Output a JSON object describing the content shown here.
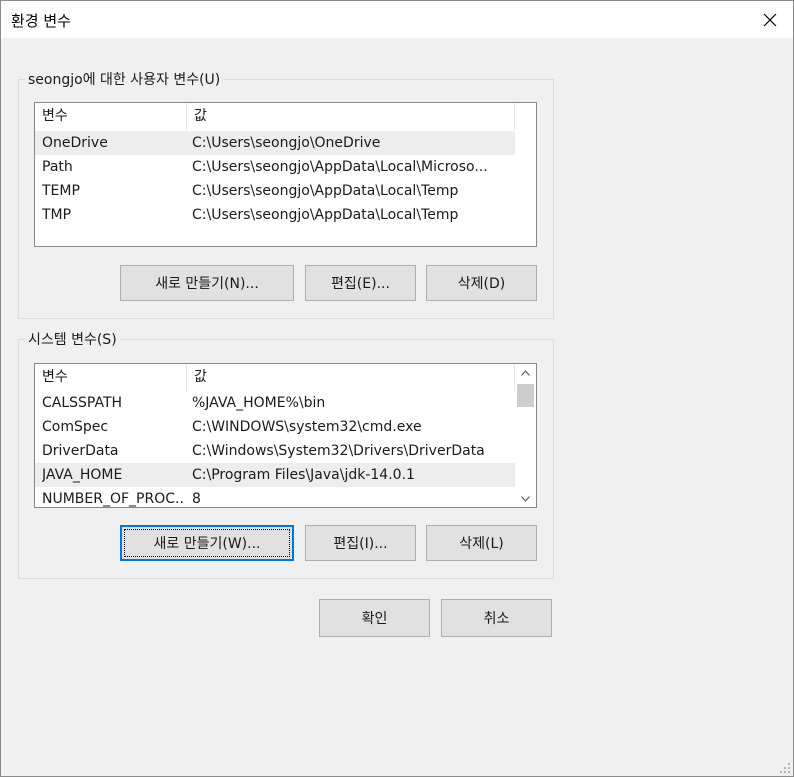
{
  "window": {
    "title": "환경 변수",
    "close_icon": "close-icon"
  },
  "user_vars": {
    "label": "seongjo에 대한 사용자 변수(U)",
    "columns": [
      "변수",
      "값"
    ],
    "rows": [
      {
        "name": "OneDrive",
        "value": "C:\\Users\\seongjo\\OneDrive"
      },
      {
        "name": "Path",
        "value": "C:\\Users\\seongjo\\AppData\\Local\\Microso..."
      },
      {
        "name": "TEMP",
        "value": "C:\\Users\\seongjo\\AppData\\Local\\Temp"
      },
      {
        "name": "TMP",
        "value": "C:\\Users\\seongjo\\AppData\\Local\\Temp"
      }
    ],
    "selected_row": "OneDrive",
    "buttons": {
      "new": "새로 만들기(N)...",
      "edit": "편집(E)...",
      "delete": "삭제(D)"
    }
  },
  "system_vars": {
    "label": "시스템 변수(S)",
    "columns": [
      "변수",
      "값"
    ],
    "rows": [
      {
        "name": "CALSSPATH",
        "value": "%JAVA_HOME%\\bin"
      },
      {
        "name": "ComSpec",
        "value": "C:\\WINDOWS\\system32\\cmd.exe"
      },
      {
        "name": "DriverData",
        "value": "C:\\Windows\\System32\\Drivers\\DriverData"
      },
      {
        "name": "JAVA_HOME",
        "value": "C:\\Program Files\\Java\\jdk-14.0.1"
      },
      {
        "name": "NUMBER_OF_PROC...",
        "value": "8"
      }
    ],
    "selected_row": "JAVA_HOME",
    "buttons": {
      "new": "새로 만들기(W)...",
      "edit": "편집(I)...",
      "delete": "삭제(L)"
    }
  },
  "footer": {
    "ok": "확인",
    "cancel": "취소"
  },
  "colors": {
    "accent": "#0078d7",
    "background": "#f0f0f0",
    "selection": "#ededed"
  }
}
